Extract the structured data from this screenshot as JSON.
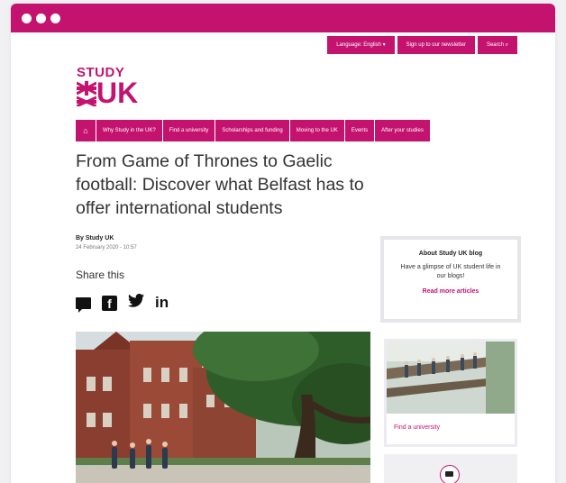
{
  "colors": {
    "brand": "#c4136e"
  },
  "window": {
    "controls": [
      "dot",
      "dot",
      "dot"
    ]
  },
  "utility_bar": {
    "language": "Language: English ▾",
    "newsletter": "Sign up to our newsletter",
    "search": "Search  ⌕"
  },
  "logo": {
    "line1": "STUDY",
    "line2": "UK"
  },
  "nav": {
    "home_icon": "home-icon",
    "items": [
      "Why Study in the UK?",
      "Find a university",
      "Scholarships and funding",
      "Moving to the UK",
      "Events",
      "After your studies"
    ]
  },
  "article": {
    "title": "From Game of Thrones to Gaelic football: Discover what Belfast has to offer international students",
    "author": "By Study UK",
    "date": "24 February 2020 - 10:57",
    "share_label": "Share this",
    "share_icons": [
      "chat-icon",
      "facebook-icon",
      "twitter-icon",
      "linkedin-icon"
    ]
  },
  "sidebar": {
    "blog_title": "About Study UK blog",
    "blog_desc": "Have a glimpse of UK student life in our blogs!",
    "blog_link": "Read more articles",
    "card_link": "Find a university",
    "mail_icon": "mail-icon"
  }
}
